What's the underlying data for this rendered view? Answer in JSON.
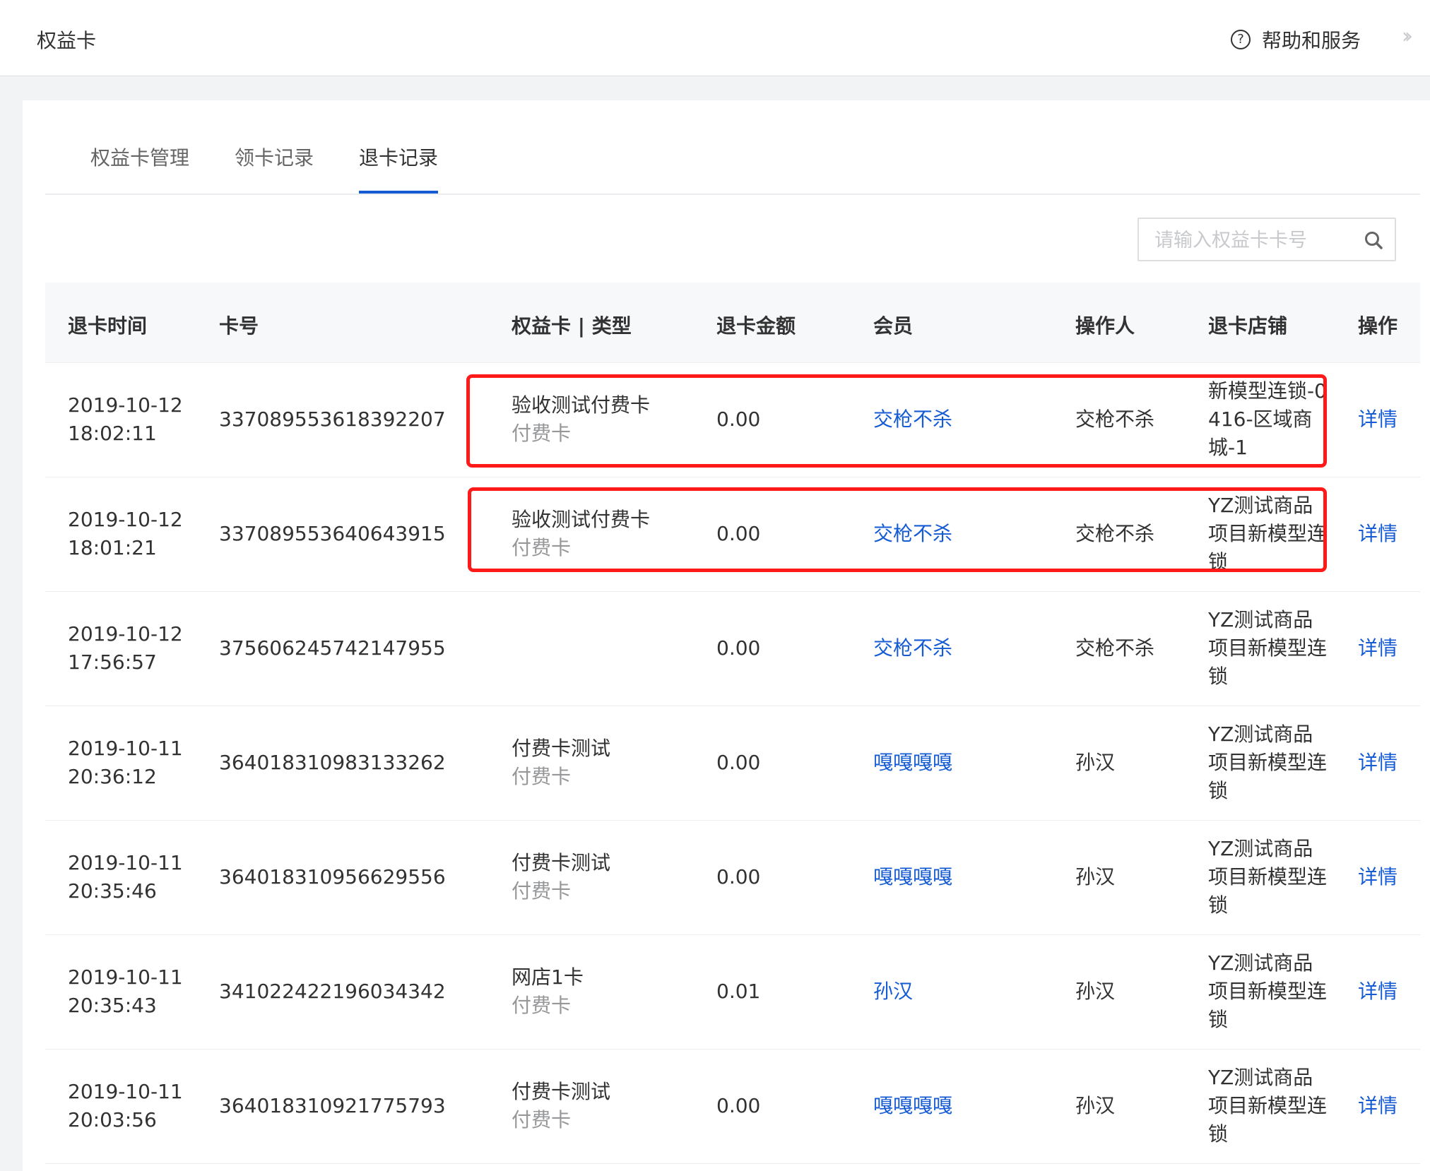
{
  "header": {
    "title": "权益卡",
    "help_label": "帮助和服务",
    "help_icon": "question-circle-icon",
    "collapse_icon": "double-chevron-right-icon"
  },
  "tabs": [
    {
      "label": "权益卡管理",
      "active": false
    },
    {
      "label": "领卡记录",
      "active": false
    },
    {
      "label": "退卡记录",
      "active": true
    }
  ],
  "search": {
    "placeholder": "请输入权益卡卡号",
    "value": "",
    "icon": "search-icon"
  },
  "table": {
    "columns": [
      "退卡时间",
      "卡号",
      "权益卡 | 类型",
      "退卡金额",
      "会员",
      "操作人",
      "退卡店铺",
      "操作"
    ],
    "rows": [
      {
        "time": "2019-10-12 18:02:11",
        "card_no": "337089553618392207",
        "card_name": "验收测试付费卡",
        "card_type": "付费卡",
        "amount": "0.00",
        "member": "交枪不杀",
        "operator": "交枪不杀",
        "store": "新模型连锁-0416-区域商城-1",
        "action": "详情"
      },
      {
        "time": "2019-10-12 18:01:21",
        "card_no": "337089553640643915",
        "card_name": "验收测试付费卡",
        "card_type": "付费卡",
        "amount": "0.00",
        "member": "交枪不杀",
        "operator": "交枪不杀",
        "store": "YZ测试商品项目新模型连锁",
        "action": "详情"
      },
      {
        "time": "2019-10-12 17:56:57",
        "card_no": "375606245742147955",
        "card_name": "",
        "card_type": "",
        "amount": "0.00",
        "member": "交枪不杀",
        "operator": "交枪不杀",
        "store": "YZ测试商品项目新模型连锁",
        "action": "详情"
      },
      {
        "time": "2019-10-11 20:36:12",
        "card_no": "364018310983133262",
        "card_name": "付费卡测试",
        "card_type": "付费卡",
        "amount": "0.00",
        "member": "嘎嘎嘎嘎",
        "operator": "孙汉",
        "store": "YZ测试商品项目新模型连锁",
        "action": "详情"
      },
      {
        "time": "2019-10-11 20:35:46",
        "card_no": "364018310956629556",
        "card_name": "付费卡测试",
        "card_type": "付费卡",
        "amount": "0.00",
        "member": "嘎嘎嘎嘎",
        "operator": "孙汉",
        "store": "YZ测试商品项目新模型连锁",
        "action": "详情"
      },
      {
        "time": "2019-10-11 20:35:43",
        "card_no": "341022422196034342",
        "card_name": "网店1卡",
        "card_type": "付费卡",
        "amount": "0.01",
        "member": "孙汉",
        "operator": "孙汉",
        "store": "YZ测试商品项目新模型连锁",
        "action": "详情"
      },
      {
        "time": "2019-10-11 20:03:56",
        "card_no": "364018310921775793",
        "card_name": "付费卡测试",
        "card_type": "付费卡",
        "amount": "0.00",
        "member": "嘎嘎嘎嘎",
        "operator": "孙汉",
        "store": "YZ测试商品项目新模型连锁",
        "action": "详情"
      }
    ]
  },
  "annotations": {
    "highlight_color": "#ff1a1a",
    "highlighted_rows": [
      0,
      1
    ]
  }
}
